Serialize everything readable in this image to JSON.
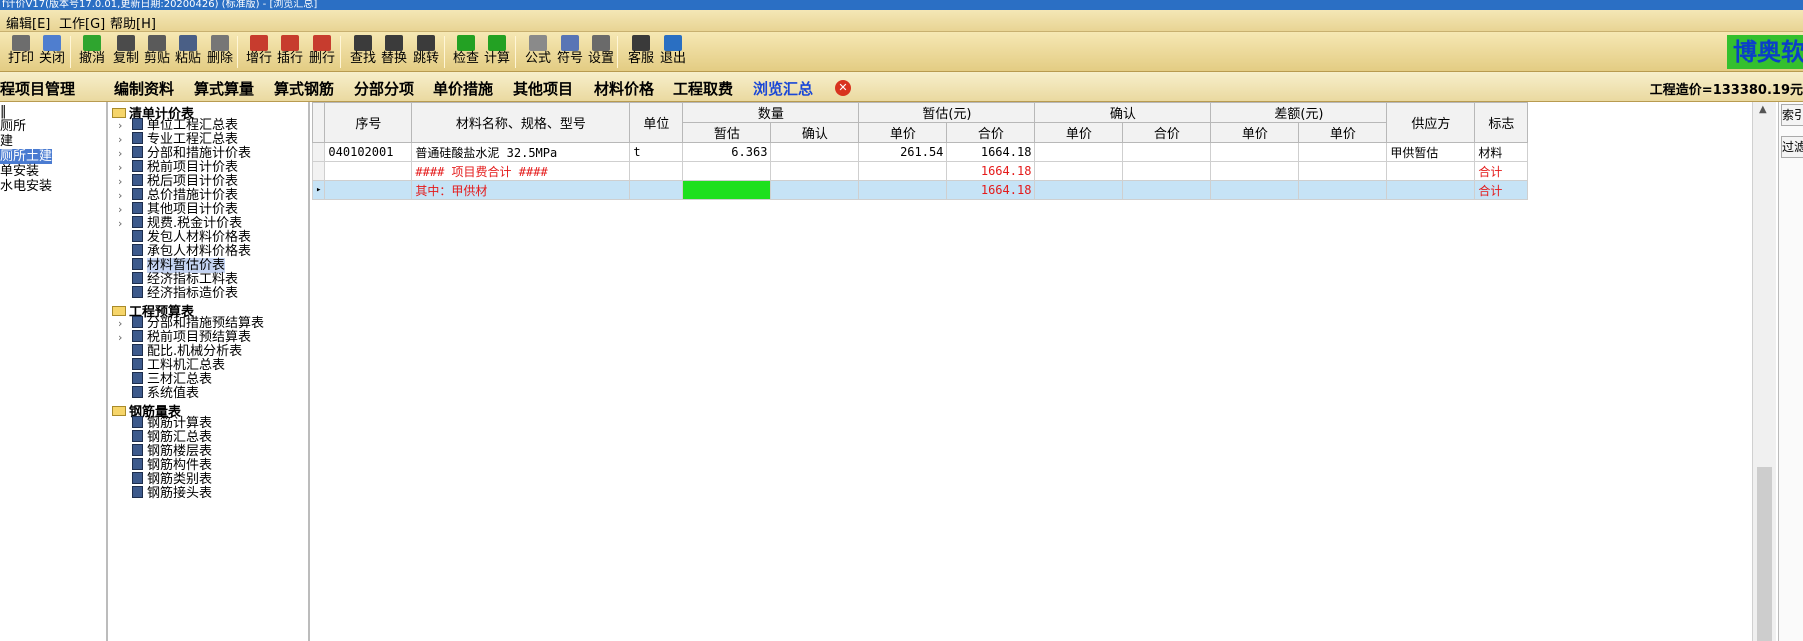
{
  "window": {
    "title": "f计价V17(版本号17.0.01,更新日期:20200426) (标准版) - [浏览汇总]"
  },
  "menu": [
    "编辑[E]",
    "工作[G]",
    "帮助[H]"
  ],
  "toolbar": {
    "buttons": [
      {
        "label": "打印",
        "icon": "printer-icon",
        "color": "#6d6d6d"
      },
      {
        "label": "关闭",
        "icon": "close-window-icon",
        "color": "#4f7ecf"
      },
      {
        "label": "撤消",
        "icon": "undo-icon",
        "color": "#2fa52f"
      },
      {
        "label": "复制",
        "icon": "copy-icon",
        "color": "#4b4b4b"
      },
      {
        "label": "剪贴",
        "icon": "scissors-icon",
        "color": "#5a5a5a"
      },
      {
        "label": "粘贴",
        "icon": "paste-icon",
        "color": "#4a5f86"
      },
      {
        "label": "删除",
        "icon": "trash-icon",
        "color": "#767676"
      },
      {
        "label": "增行",
        "icon": "insert-row-icon",
        "color": "#c73c2e"
      },
      {
        "label": "插行",
        "icon": "add-row-icon",
        "color": "#c73c2e"
      },
      {
        "label": "删行",
        "icon": "delete-row-icon",
        "color": "#c73c2e"
      },
      {
        "label": "查找",
        "icon": "binoculars-icon",
        "color": "#3b3b3b"
      },
      {
        "label": "替换",
        "icon": "replace-icon",
        "color": "#3b3b3b"
      },
      {
        "label": "跳转",
        "icon": "jump-icon",
        "color": "#3b3b3b"
      },
      {
        "label": "检查",
        "icon": "check-icon",
        "color": "#23a123"
      },
      {
        "label": "计算",
        "icon": "calculate-icon",
        "color": "#23a123"
      },
      {
        "label": "公式",
        "icon": "calculator-icon",
        "color": "#8a8a8a"
      },
      {
        "label": "符号",
        "icon": "symbol-icon",
        "color": "#5875b5"
      },
      {
        "label": "设置",
        "icon": "tools-icon",
        "color": "#6a6a6a"
      },
      {
        "label": "客服",
        "icon": "headset-icon",
        "color": "#3a3a3a"
      },
      {
        "label": "退出",
        "icon": "exit-icon",
        "color": "#2a6fc2"
      }
    ],
    "brand": "博奥软"
  },
  "nav": {
    "project_title": "程项目管理",
    "tabs": [
      "编制资料",
      "算式算量",
      "算式钢筋",
      "分部分项",
      "单价措施",
      "其他项目",
      "材料价格",
      "工程取费",
      "浏览汇总"
    ],
    "active_tab": "浏览汇总",
    "cost_label": "工程造价=133380.19元"
  },
  "left_panel": {
    "items": [
      "‖",
      "厕所",
      "建",
      "厕所土建",
      "单安装",
      "水电安装"
    ],
    "selected": "厕所土建"
  },
  "tree": {
    "groups": [
      {
        "label": "清单计价表",
        "items": [
          {
            "label": "单位工程汇总表",
            "expandable": true
          },
          {
            "label": "专业工程汇总表",
            "expandable": true
          },
          {
            "label": "分部和措施计价表",
            "expandable": true
          },
          {
            "label": "税前项目计价表",
            "expandable": true
          },
          {
            "label": "税后项目计价表",
            "expandable": true
          },
          {
            "label": "总价措施计价表",
            "expandable": true
          },
          {
            "label": "其他项目计价表",
            "expandable": true
          },
          {
            "label": "规费.税金计价表",
            "expandable": true
          },
          {
            "label": "发包人材料价格表",
            "expandable": false
          },
          {
            "label": "承包人材料价格表",
            "expandable": false
          },
          {
            "label": "材料暂估价表",
            "expandable": false,
            "selected": true
          },
          {
            "label": "经济指标工料表",
            "expandable": false
          },
          {
            "label": "经济指标造价表",
            "expandable": false
          }
        ]
      },
      {
        "label": "工程预算表",
        "items": [
          {
            "label": "分部和措施预结算表",
            "expandable": true
          },
          {
            "label": "税前项目预结算表",
            "expandable": true
          },
          {
            "label": "配比.机械分析表",
            "expandable": false
          },
          {
            "label": "工料机汇总表",
            "expandable": false
          },
          {
            "label": "三材汇总表",
            "expandable": false
          },
          {
            "label": "系统值表",
            "expandable": false
          }
        ]
      },
      {
        "label": "钢筋量表",
        "items": [
          {
            "label": "钢筋计算表",
            "expandable": false
          },
          {
            "label": "钢筋汇总表",
            "expandable": false
          },
          {
            "label": "钢筋楼层表",
            "expandable": false
          },
          {
            "label": "钢筋构件表",
            "expandable": false
          },
          {
            "label": "钢筋类别表",
            "expandable": false
          },
          {
            "label": "钢筋接头表",
            "expandable": false
          }
        ]
      }
    ]
  },
  "table": {
    "header_top": {
      "seq": "序号",
      "name": "材料名称、规格、型号",
      "unit": "单位",
      "qty": "数量",
      "est": "暂估(元)",
      "confirm": "确认",
      "diff": "差额(元)",
      "supplier": "供应方",
      "flag": "标志"
    },
    "header_sub": {
      "qty_est": "暂估",
      "qty_confirm": "确认",
      "est_price": "单价",
      "est_total": "合价",
      "confirm_price": "单价",
      "confirm_total": "合价",
      "diff_price": "单价",
      "diff_total": "单价"
    },
    "rows": [
      {
        "seq": "040102001",
        "name": "普通硅酸盐水泥 32.5MPa",
        "unit": "t",
        "qty_est": "6.363",
        "qty_confirm": "",
        "est_price": "261.54",
        "est_total": "1664.18",
        "confirm_price": "",
        "confirm_total": "",
        "diff_price": "",
        "diff_total": "",
        "supplier": "甲供暂估",
        "flag": "材料"
      },
      {
        "seq": "",
        "name": "#### 项目费合计 ####",
        "unit": "",
        "qty_est": "",
        "qty_confirm": "",
        "est_price": "",
        "est_total": "1664.18",
        "confirm_price": "",
        "confirm_total": "",
        "diff_price": "",
        "diff_total": "",
        "supplier": "",
        "flag": "合计"
      },
      {
        "seq": "",
        "name": "其中：甲供材",
        "unit": "",
        "qty_est": "",
        "qty_confirm": "",
        "est_price": "",
        "est_total": "1664.18",
        "confirm_price": "",
        "confirm_total": "",
        "diff_price": "",
        "diff_total": "",
        "supplier": "",
        "flag": "合计"
      }
    ]
  },
  "right_panel": {
    "buttons": [
      "索引",
      "过滤"
    ]
  }
}
